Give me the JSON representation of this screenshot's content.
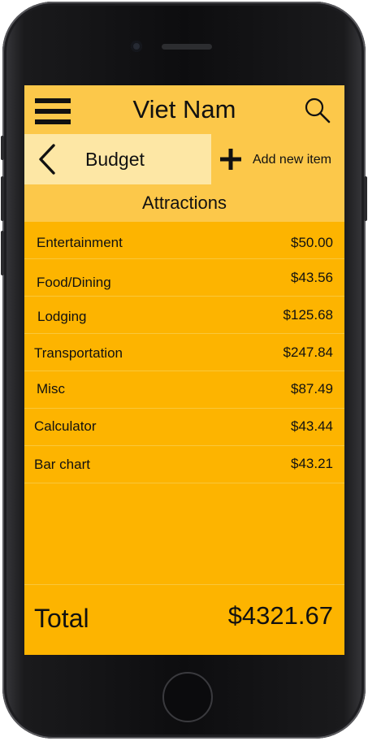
{
  "colors": {
    "screen_background": "#fdb400",
    "header_background": "#fcc84a",
    "back_area_background": "#fde7a5",
    "text": "#111111"
  },
  "header": {
    "title": "Viet Nam",
    "menu_icon": "hamburger-menu-icon",
    "search_icon": "search-icon"
  },
  "subheader": {
    "back_icon": "chevron-left-icon",
    "label": "Budget",
    "add_icon": "plus-icon",
    "add_label": "Add new item"
  },
  "section": {
    "title": "Attractions"
  },
  "items": [
    {
      "name": "Entertainment",
      "amount": "$50.00"
    },
    {
      "name": "Food/Dining",
      "amount": "$43.56"
    },
    {
      "name": "Lodging",
      "amount": "$125.68"
    },
    {
      "name": "Transportation",
      "amount": "$247.84"
    },
    {
      "name": "Misc",
      "amount": "$87.49"
    },
    {
      "name": "Calculator",
      "amount": "$43.44"
    },
    {
      "name": "Bar chart",
      "amount": "$43.21"
    }
  ],
  "total": {
    "label": "Total",
    "value": "$4321.67"
  }
}
